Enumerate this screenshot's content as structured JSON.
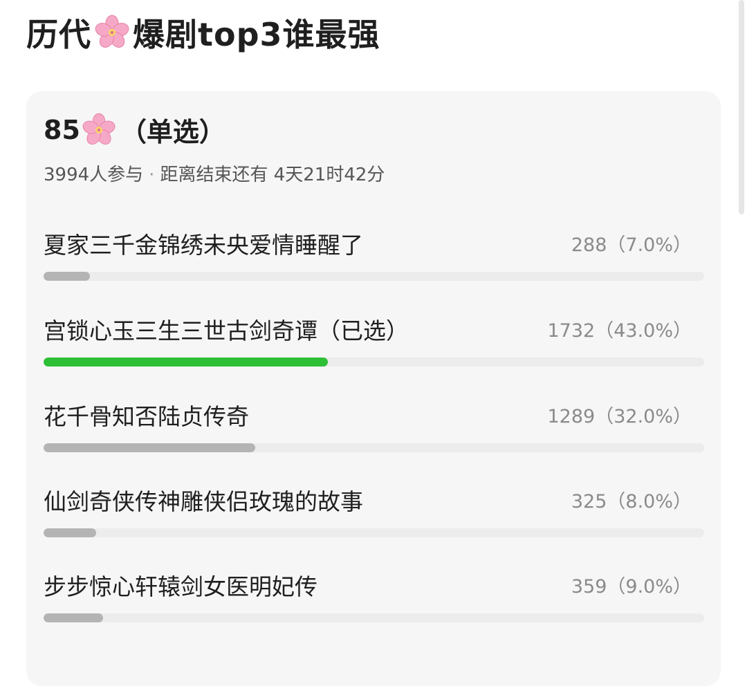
{
  "post": {
    "title_before": "历代",
    "title_after": "爆剧top3谁最强",
    "title_icon": "cherry-blossom-emoji"
  },
  "poll": {
    "heading_number": "85",
    "heading_icon": "cherry-blossom-emoji",
    "heading_mode": "（单选）",
    "participants": "3994人参与",
    "separator": "·",
    "time_left": "距离结束还有 4天21时42分",
    "options": [
      {
        "label": "夏家三千金锦绣未央爱情睡醒了",
        "count": "288（7.0%）",
        "percent": 7.0,
        "selected": false
      },
      {
        "label": "宫锁心玉三生三世古剑奇谭（已选）",
        "count": "1732（43.0%）",
        "percent": 43.0,
        "selected": true
      },
      {
        "label": "花千骨知否陆贞传奇",
        "count": "1289（32.0%）",
        "percent": 32.0,
        "selected": false
      },
      {
        "label": "仙剑奇侠传神雕侠侣玫瑰的故事",
        "count": "325（8.0%）",
        "percent": 8.0,
        "selected": false
      },
      {
        "label": "步步惊心轩辕剑女医明妃传",
        "count": "359（9.0%）",
        "percent": 9.0,
        "selected": false
      }
    ]
  },
  "colors": {
    "selected_bar": "#2dbf36",
    "unselected_bar": "#b4b4b4",
    "track": "#ececec",
    "card_bg": "#f6f6f6"
  }
}
